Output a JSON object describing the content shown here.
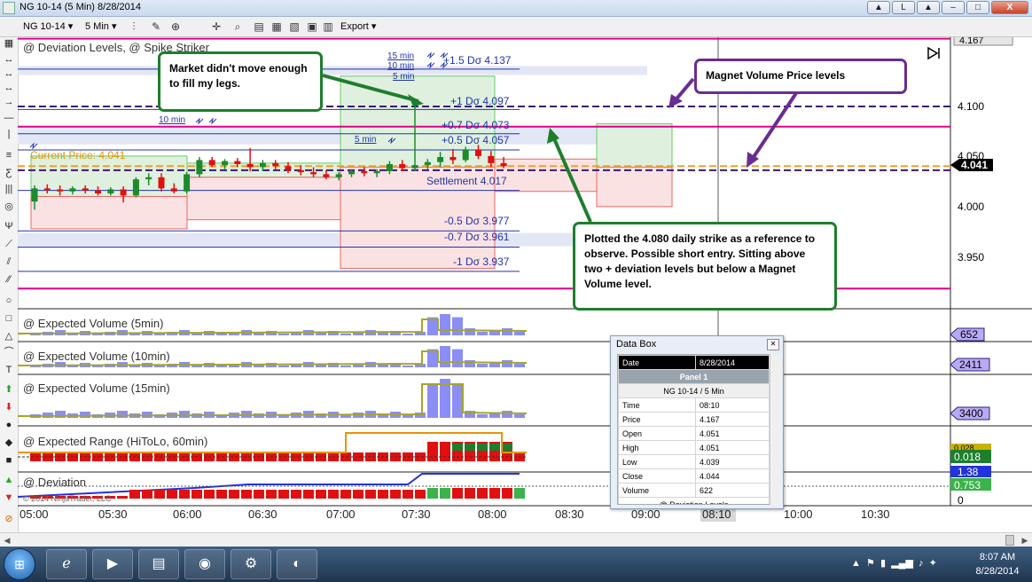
{
  "window": {
    "title": "NG 10-14 (5 Min)  8/28/2014",
    "buttons": {
      "up": "▲",
      "link": "L",
      "restore": "▲",
      "min": "–",
      "max": "□",
      "close": "X"
    }
  },
  "toolbar": {
    "instrument": "NG 10-14",
    "interval": "5 Min",
    "export": "Export"
  },
  "callouts": {
    "legs": "Market didn't move enough to fill my legs.",
    "magnet": "Magnet Volume Price levels",
    "strike": "Plotted the 4.080 daily strike as a reference to observe.  Possible short entry.  Sitting above two + deviation levels but below a Magnet Volume level."
  },
  "panels": {
    "price": "@ Deviation Levels, @ Spike Striker",
    "ev5": "@ Expected Volume (5min)",
    "ev10": "@ Expected Volume (10min)",
    "ev15": "@ Expected Volume (15min)",
    "range": "@ Expected Range (HiToLo, 60min)",
    "dev": "@ Deviation"
  },
  "copyright": "© 2014 NinjaTrader, LLC",
  "markers": {
    "m15": "15 min",
    "m10": "10 min",
    "m5": "5 min"
  },
  "price_labels": {
    "current": "Current Price: 4.041",
    "p15": "+1.5 Dσ 4.137",
    "p1": "+1 Dσ 4.097",
    "p07": "+0.7 Dσ 4.073",
    "p05": "+0.5 Dσ 4.057",
    "settle": "Settlement 4.017",
    "m05": "-0.5 Dσ 3.977",
    "m07": "-0.7 Dσ 3.961",
    "m1": "-1 Dσ 3.937"
  },
  "axis": {
    "price_ticks": [
      "4.100",
      "4.050",
      "4.000",
      "3.950"
    ],
    "top_value": "4.167",
    "current_value": "4.041",
    "ev5": "652",
    "ev10": "2411",
    "ev15": "3400",
    "range_a": "0.028",
    "range_b": "0.018",
    "dev_a": "1.38",
    "dev_b": "0.753",
    "dev_zero": "0",
    "time_ticks": [
      "05:00",
      "05:30",
      "06:00",
      "06:30",
      "07:00",
      "07:30",
      "08:00",
      "08:30",
      "09:00",
      "08:10",
      "10:00",
      "10:30"
    ]
  },
  "databox": {
    "title": "Data Box",
    "date_label": "Date",
    "date_value": "8/28/2014",
    "panel": "Panel 1",
    "instrument": "NG 10-14 / 5 Min",
    "rows": [
      {
        "k": "Time",
        "v": "08:10"
      },
      {
        "k": "Price",
        "v": "4.167"
      },
      {
        "k": "Open",
        "v": "4.051"
      },
      {
        "k": "High",
        "v": "4.051"
      },
      {
        "k": "Low",
        "v": "4.039"
      },
      {
        "k": "Close",
        "v": "4.044"
      },
      {
        "k": "Volume",
        "v": "622"
      }
    ],
    "footer": "@ Deviation Levels"
  },
  "taskbar": {
    "time": "8:07 AM",
    "date": "8/28/2014"
  },
  "chart_data": {
    "type": "candlestick",
    "title": "@ Deviation Levels, @ Spike Striker",
    "x_axis": "time (5 min bars)",
    "ylim": [
      3.915,
      4.17
    ],
    "ohlc": [
      [
        "05:00",
        4.006,
        4.022,
        3.998,
        4.019
      ],
      [
        "05:05",
        4.019,
        4.023,
        4.014,
        4.018
      ],
      [
        "05:10",
        4.018,
        4.022,
        4.012,
        4.016
      ],
      [
        "05:15",
        4.016,
        4.021,
        4.013,
        4.019
      ],
      [
        "05:20",
        4.019,
        4.022,
        4.014,
        4.017
      ],
      [
        "05:25",
        4.017,
        4.021,
        4.012,
        4.014
      ],
      [
        "05:30",
        4.014,
        4.02,
        4.012,
        4.018
      ],
      [
        "05:35",
        4.018,
        4.021,
        4.005,
        4.012
      ],
      [
        "05:40",
        4.012,
        4.03,
        4.01,
        4.028
      ],
      [
        "05:45",
        4.028,
        4.034,
        4.022,
        4.03
      ],
      [
        "05:50",
        4.03,
        4.034,
        4.016,
        4.019
      ],
      [
        "05:55",
        4.019,
        4.024,
        4.014,
        4.016
      ],
      [
        "06:00",
        4.016,
        4.035,
        4.014,
        4.033
      ],
      [
        "06:05",
        4.033,
        4.05,
        4.03,
        4.047
      ],
      [
        "06:10",
        4.047,
        4.05,
        4.04,
        4.042
      ],
      [
        "06:15",
        4.042,
        4.048,
        4.038,
        4.046
      ],
      [
        "06:20",
        4.046,
        4.049,
        4.04,
        4.043
      ],
      [
        "06:25",
        4.043,
        4.059,
        4.036,
        4.04
      ],
      [
        "06:30",
        4.04,
        4.047,
        4.036,
        4.044
      ],
      [
        "06:35",
        4.044,
        4.047,
        4.038,
        4.041
      ],
      [
        "06:40",
        4.041,
        4.045,
        4.034,
        4.037
      ],
      [
        "06:45",
        4.037,
        4.042,
        4.032,
        4.035
      ],
      [
        "06:50",
        4.035,
        4.04,
        4.03,
        4.033
      ],
      [
        "06:55",
        4.033,
        4.037,
        4.028,
        4.03
      ],
      [
        "07:00",
        4.03,
        4.035,
        4.027,
        4.033
      ],
      [
        "07:05",
        4.033,
        4.038,
        4.03,
        4.036
      ],
      [
        "07:10",
        4.036,
        4.04,
        4.031,
        4.034
      ],
      [
        "07:15",
        4.034,
        4.038,
        4.03,
        4.036
      ],
      [
        "07:20",
        4.036,
        4.046,
        4.033,
        4.043
      ],
      [
        "07:25",
        4.043,
        4.047,
        4.036,
        4.039
      ],
      [
        "07:30",
        4.039,
        4.104,
        4.036,
        4.042
      ],
      [
        "07:35",
        4.042,
        4.048,
        4.038,
        4.045
      ],
      [
        "07:40",
        4.045,
        4.055,
        4.04,
        4.05
      ],
      [
        "07:45",
        4.05,
        4.058,
        4.043,
        4.047
      ],
      [
        "07:50",
        4.047,
        4.06,
        4.045,
        4.057
      ],
      [
        "07:55",
        4.057,
        4.062,
        4.048,
        4.051
      ],
      [
        "08:00",
        4.051,
        4.056,
        4.04,
        4.044
      ],
      [
        "08:05",
        4.044,
        4.05,
        4.039,
        4.041
      ]
    ],
    "levels": [
      {
        "name": "+1.5 Dσ",
        "value": 4.137
      },
      {
        "name": "+1 Dσ",
        "value": 4.097
      },
      {
        "name": "+0.7 Dσ",
        "value": 4.073
      },
      {
        "name": "+0.5 Dσ",
        "value": 4.057
      },
      {
        "name": "Settlement",
        "value": 4.017
      },
      {
        "name": "-0.5 Dσ",
        "value": 3.977
      },
      {
        "name": "-0.7 Dσ",
        "value": 3.961
      },
      {
        "name": "-1 Dσ",
        "value": 3.937
      }
    ],
    "strike_level": 4.08,
    "magnet_levels": [
      4.1,
      4.041,
      4.037
    ],
    "current_price": 4.041
  }
}
